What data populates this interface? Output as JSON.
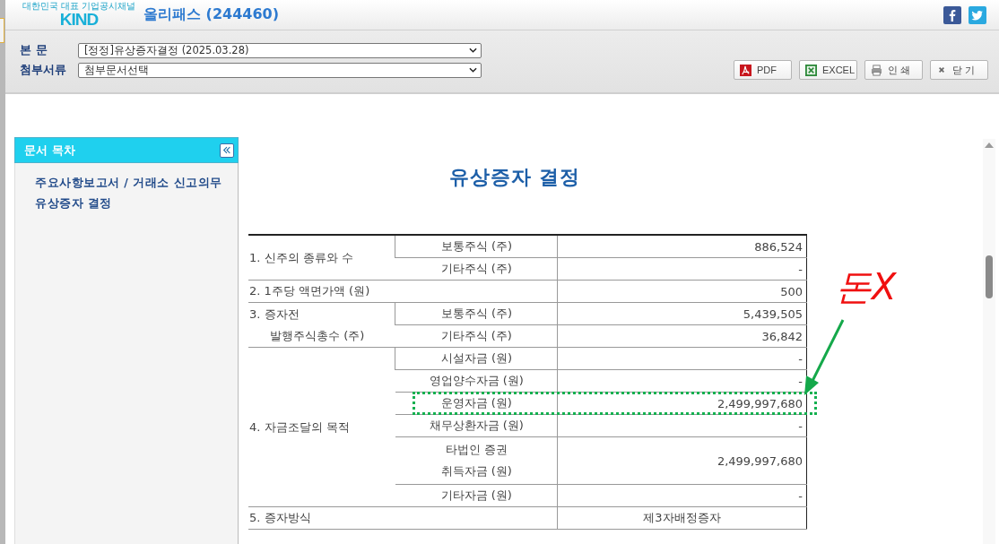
{
  "header": {
    "logo": "KIND",
    "logo_tagline": "대한민국 대표 기업공시채널",
    "title": "올리패스 (244460)"
  },
  "selectors": [
    {
      "label": "본 문",
      "value": "[정정]유상증자결정 (2025.03.28)"
    },
    {
      "label": "첨부서류",
      "value": "첨부문서선택"
    }
  ],
  "buttons": [
    {
      "kind": "pdf",
      "label": "PDF"
    },
    {
      "kind": "excel",
      "label": "EXCEL"
    },
    {
      "kind": "print",
      "label": "인 쇄"
    },
    {
      "kind": "close",
      "label": "닫 기"
    }
  ],
  "toc": {
    "title": "문서 목차",
    "items": [
      "주요사항보고서 / 거래소 신고의무",
      "유상증자 결정"
    ]
  },
  "document": {
    "title": "유상증자 결정",
    "rows": [
      {
        "lines": [
          "1. 신주의 종류와 수"
        ],
        "subs": [
          {
            "lines": [
              "보통주식 (주)"
            ],
            "value": "886,524",
            "highlighted": false
          },
          {
            "lines": [
              "기타주식 (주)"
            ],
            "value": "-",
            "highlighted": false
          }
        ]
      },
      {
        "lines": [
          "2. 1주당 액면가액 (원)"
        ],
        "value": "500"
      },
      {
        "lines": [
          "3. 증자전",
          "발행주식총수 (주)"
        ],
        "subs": [
          {
            "lines": [
              "보통주식 (주)"
            ],
            "value": "5,439,505",
            "highlighted": false
          },
          {
            "lines": [
              "기타주식 (주)"
            ],
            "value": "36,842",
            "highlighted": false
          }
        ]
      },
      {
        "lines": [
          "4. 자금조달의 목적"
        ],
        "subs": [
          {
            "lines": [
              "시설자금 (원)"
            ],
            "value": "-",
            "highlighted": false
          },
          {
            "lines": [
              "영업양수자금 (원)"
            ],
            "value": "-",
            "highlighted": false
          },
          {
            "lines": [
              "운영자금 (원)"
            ],
            "value": "2,499,997,680",
            "highlighted": true
          },
          {
            "lines": [
              "채무상환자금 (원)"
            ],
            "value": "-",
            "highlighted": false
          },
          {
            "lines": [
              "타법인 증권",
              "취득자금 (원)"
            ],
            "value": "2,499,997,680",
            "highlighted": false
          },
          {
            "lines": [
              "기타자금 (원)"
            ],
            "value": "-",
            "highlighted": false
          }
        ]
      },
      {
        "lines": [
          "5. 증자방식"
        ],
        "value": "제3자배정증자"
      }
    ]
  },
  "annotation": {
    "text": "돈X"
  }
}
